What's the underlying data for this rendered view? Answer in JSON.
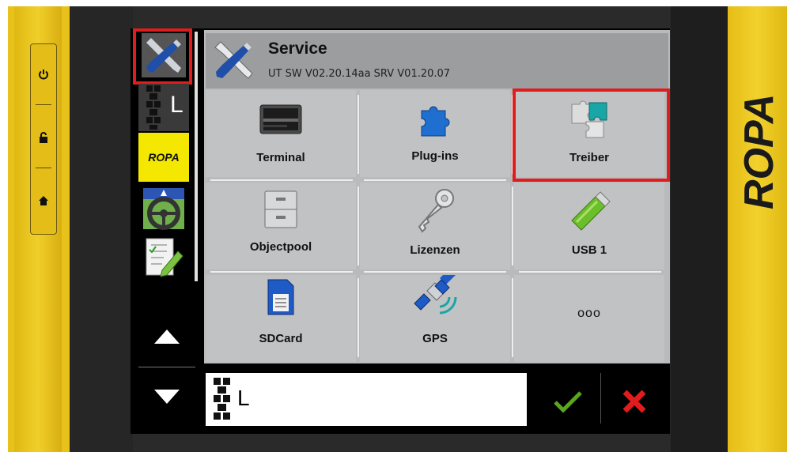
{
  "device": {
    "brand": "ROPA",
    "side_buttons": [
      "power-icon",
      "lock-icon",
      "home-icon"
    ]
  },
  "nav": {
    "items": [
      "wrench-screwdriver-icon",
      "implement-l-icon",
      "ropa-logo",
      "steering-wheel-icon",
      "checklist-icon"
    ],
    "implement_letter": "L",
    "ropa_label": "ROPA"
  },
  "header": {
    "title": "Service",
    "subtitle": "UT SW V02.20.14aa SRV V01.20.07"
  },
  "tiles": [
    {
      "label": "Terminal",
      "icon": "terminal-icon"
    },
    {
      "label": "Plug-ins",
      "icon": "puzzle-piece-icon"
    },
    {
      "label": "Treiber",
      "icon": "driver-puzzle-icon"
    },
    {
      "label": "Objectpool",
      "icon": "filing-cabinet-icon"
    },
    {
      "label": "Lizenzen",
      "icon": "key-icon"
    },
    {
      "label": "USB 1",
      "icon": "usb-stick-icon"
    },
    {
      "label": "SDCard",
      "icon": "sd-card-icon"
    },
    {
      "label": "GPS",
      "icon": "satellite-icon"
    },
    {
      "label": "ooo",
      "icon": "more-icon"
    }
  ],
  "bottom": {
    "input_letter": "L"
  },
  "colors": {
    "highlight": "#e01c1c",
    "brand_yellow": "#f0cf2a",
    "confirm": "#5aa61e",
    "cancel": "#e01c1c"
  }
}
